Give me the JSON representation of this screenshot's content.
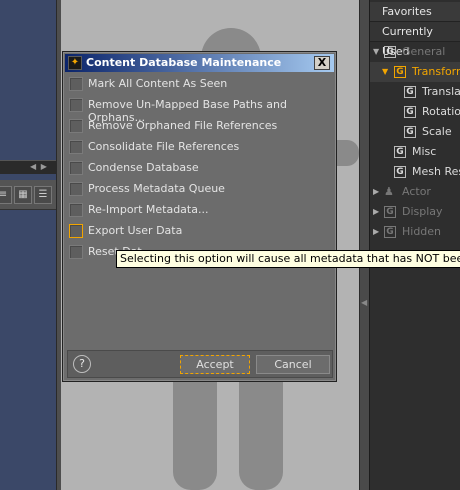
{
  "dialog": {
    "title": "Content Database Maintenance",
    "close_label": "X",
    "options": [
      {
        "label": "Mark All Content As Seen"
      },
      {
        "label": "Remove Un-Mapped Base Paths and Orphans..."
      },
      {
        "label": "Remove Orphaned File References"
      },
      {
        "label": "Consolidate File References"
      },
      {
        "label": "Condense Database"
      },
      {
        "label": "Process Metadata Queue"
      },
      {
        "label": "Re-Import Metadata..."
      },
      {
        "label": "Export User Data"
      },
      {
        "label": "Reset Dat"
      }
    ],
    "help_label": "?",
    "accept_label": "Accept",
    "cancel_label": "Cancel"
  },
  "tooltip": "Selecting this option will cause all metadata that has NOT been installed",
  "right_panel": {
    "tabs": [
      "Favorites",
      "Currently Used"
    ],
    "tree": [
      {
        "label": "General",
        "icon": "G"
      },
      {
        "label": "Transforms",
        "icon": "G"
      },
      {
        "label": "Translat",
        "icon": "G"
      },
      {
        "label": "Rotation",
        "icon": "G"
      },
      {
        "label": "Scale",
        "icon": "G"
      },
      {
        "label": "Misc",
        "icon": "G"
      },
      {
        "label": "Mesh Res",
        "icon": "G"
      },
      {
        "label": "Actor"
      },
      {
        "label": "Display",
        "icon": "G"
      },
      {
        "label": "Hidden",
        "icon": "G"
      }
    ]
  },
  "colors": {
    "accent": "#f2a500",
    "dialog_bg": "#6c6c6c",
    "left_panel": "#3b4868",
    "viewport": "#b3b3b3"
  }
}
